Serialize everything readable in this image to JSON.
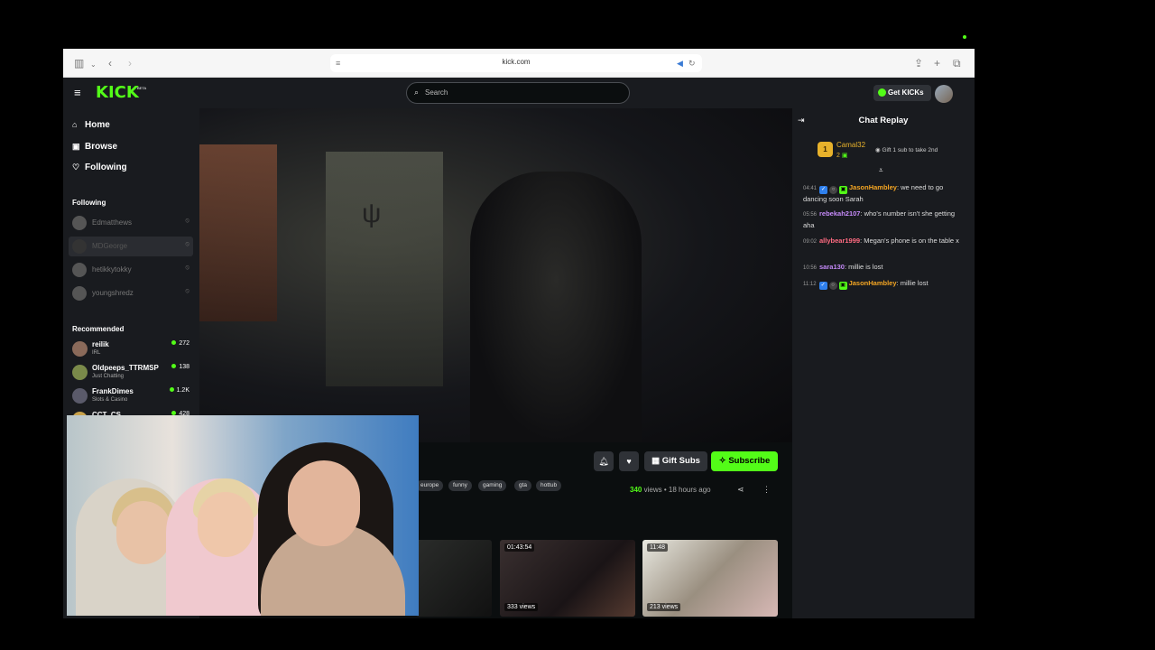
{
  "browser": {
    "url": "kick.com"
  },
  "header": {
    "logo": "KICK",
    "logo_beta": "BETA",
    "search_placeholder": "Search",
    "get_kicks": "Get KICKs"
  },
  "sidebar": {
    "nav": [
      {
        "label": "Home",
        "icon": "home-icon"
      },
      {
        "label": "Browse",
        "icon": "browse-icon"
      },
      {
        "label": "Following",
        "icon": "heart-icon"
      }
    ],
    "following_heading": "Following",
    "following": [
      {
        "name": "Edmatthews"
      },
      {
        "name": "MDGeorge"
      },
      {
        "name": "hetikkytokky"
      },
      {
        "name": "youngshredz"
      }
    ],
    "recommended_heading": "Recommended",
    "recommended": [
      {
        "name": "reilik",
        "category": "IRL",
        "viewers": "272"
      },
      {
        "name": "Oldpeeps_TTRMSP",
        "category": "Just Chatting",
        "viewers": "138"
      },
      {
        "name": "FrankDimes",
        "category": "Slots & Casino",
        "viewers": "1.2K"
      },
      {
        "name": "CCT_CS",
        "category": "",
        "viewers": "428"
      }
    ]
  },
  "video_actions": {
    "gift_subs": "Gift Subs",
    "subscribe": "Subscribe"
  },
  "tags": [
    "europe",
    "funny",
    "gaming",
    "gta",
    "hottub"
  ],
  "video_meta": {
    "views_count": "340",
    "views_label": "views",
    "separator": "•",
    "age": "18 hours ago"
  },
  "related": [
    {
      "duration": "",
      "views": ""
    },
    {
      "duration": "01:43:54",
      "views": "333 views"
    },
    {
      "duration": "11:48",
      "views": "213 views"
    }
  ],
  "chat": {
    "title": "Chat Replay",
    "top_gifter": {
      "rank": "1",
      "name": "Camal32",
      "count": "2"
    },
    "gift_cta": "Gift 1 sub to take 2nd",
    "messages": [
      {
        "time": "04:41",
        "user": "JasonHambley",
        "color": "#f5a623",
        "text": ": we need to go dancing soon Sarah"
      },
      {
        "time": "05:56",
        "user": "rebekah2107",
        "color": "#c58af9",
        "text": ": who's number isn't she getting aha"
      },
      {
        "time": "09:02",
        "user": "allybear1999",
        "color": "#ff6b81",
        "text": ": Megan's phone is on the table x"
      },
      {
        "time": "10:56",
        "user": "sara130",
        "color": "#c58af9",
        "text": ": millie is lost"
      },
      {
        "time": "11:12",
        "user": "JasonHambley",
        "color": "#f5a623",
        "text": ": millie lost"
      }
    ]
  },
  "colors": {
    "brand": "#53fc18",
    "panel": "#191b1f",
    "background": "#0b0e0f"
  }
}
